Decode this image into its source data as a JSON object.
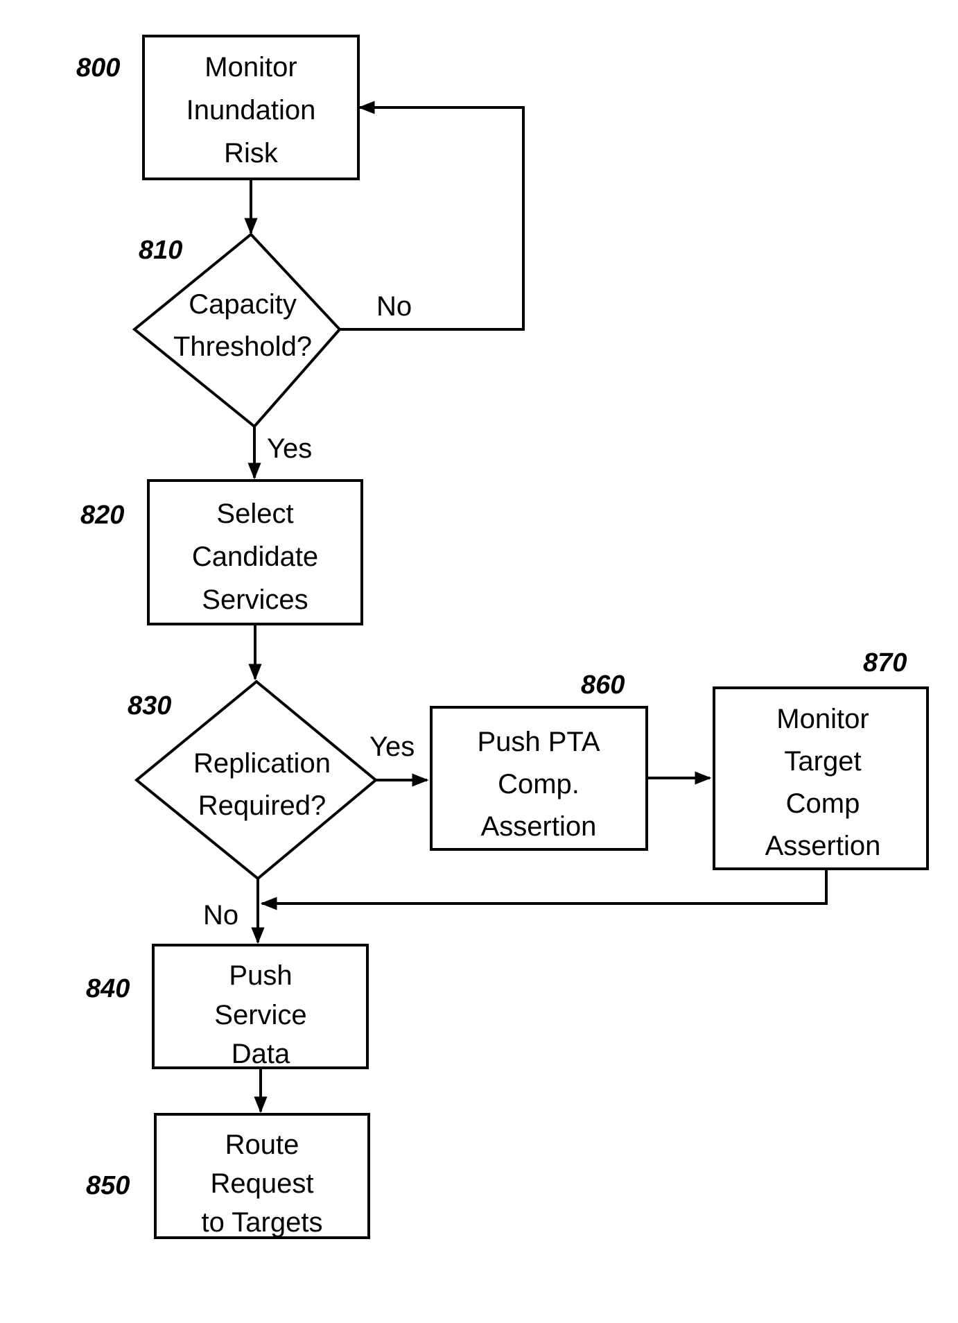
{
  "diagram": {
    "type": "flowchart",
    "nodes": [
      {
        "id": "800",
        "ref": "800",
        "shape": "process",
        "lines": [
          "Monitor",
          "Inundation",
          "Risk"
        ]
      },
      {
        "id": "810",
        "ref": "810",
        "shape": "decision",
        "lines": [
          "Capacity",
          "Threshold?"
        ]
      },
      {
        "id": "820",
        "ref": "820",
        "shape": "process",
        "lines": [
          "Select",
          "Candidate",
          "Services"
        ]
      },
      {
        "id": "830",
        "ref": "830",
        "shape": "decision",
        "lines": [
          "Replication",
          "Required?"
        ]
      },
      {
        "id": "840",
        "ref": "840",
        "shape": "process",
        "lines": [
          "Push",
          "Service",
          "Data"
        ]
      },
      {
        "id": "850",
        "ref": "850",
        "shape": "process",
        "lines": [
          "Route",
          "Request",
          "to Targets"
        ]
      },
      {
        "id": "860",
        "ref": "860",
        "shape": "process",
        "lines": [
          "Push PTA",
          "Comp.",
          "Assertion"
        ]
      },
      {
        "id": "870",
        "ref": "870",
        "shape": "process",
        "lines": [
          "Monitor",
          "Target",
          "Comp",
          "Assertion"
        ]
      }
    ],
    "edges": [
      {
        "from": "800",
        "to": "810",
        "label": ""
      },
      {
        "from": "810",
        "to": "800",
        "label": "No"
      },
      {
        "from": "810",
        "to": "820",
        "label": "Yes"
      },
      {
        "from": "820",
        "to": "830",
        "label": ""
      },
      {
        "from": "830",
        "to": "860",
        "label": "Yes"
      },
      {
        "from": "860",
        "to": "870",
        "label": ""
      },
      {
        "from": "870",
        "to": "840",
        "label": ""
      },
      {
        "from": "830",
        "to": "840",
        "label": "No"
      },
      {
        "from": "840",
        "to": "850",
        "label": ""
      }
    ]
  }
}
